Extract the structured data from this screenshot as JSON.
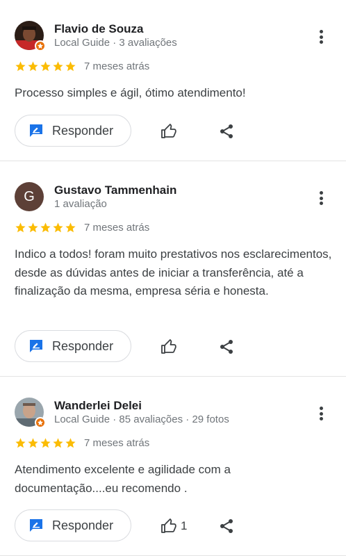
{
  "reviews": [
    {
      "name": "Flavio de Souza",
      "meta": "Local Guide · 3 avaliações",
      "rating": 5,
      "when": "7 meses atrás",
      "text": "Processo simples e ágil, ótimo atendimento!",
      "reply_label": "Responder",
      "likes": ""
    },
    {
      "name": "Gustavo Tammenhain",
      "avatar_letter": "G",
      "meta": "1 avaliação",
      "rating": 5,
      "when": "7 meses atrás",
      "text": "Indico a todos! foram muito prestativos nos esclarecimentos, desde as dúvidas antes de iniciar a transferência, até a finalização da mesma, empresa séria e honesta.",
      "reply_label": "Responder",
      "likes": ""
    },
    {
      "name": "Wanderlei Delei",
      "meta": "Local Guide · 85 avaliações · 29 fotos",
      "rating": 5,
      "when": "7 meses atrás",
      "text": "Atendimento excelente e agilidade com a documentação....eu recomendo .",
      "reply_label": "Responder",
      "likes": "1"
    }
  ],
  "colors": {
    "star": "#fbbc04",
    "reply_icon": "#1a73e8",
    "guide_badge": "#e8710a",
    "avatar_letter_bg": "#5d4037"
  },
  "icons": [
    "more-vert-icon",
    "star-icon",
    "reply-icon",
    "thumb-up-icon",
    "share-icon",
    "local-guide-badge-icon"
  ]
}
